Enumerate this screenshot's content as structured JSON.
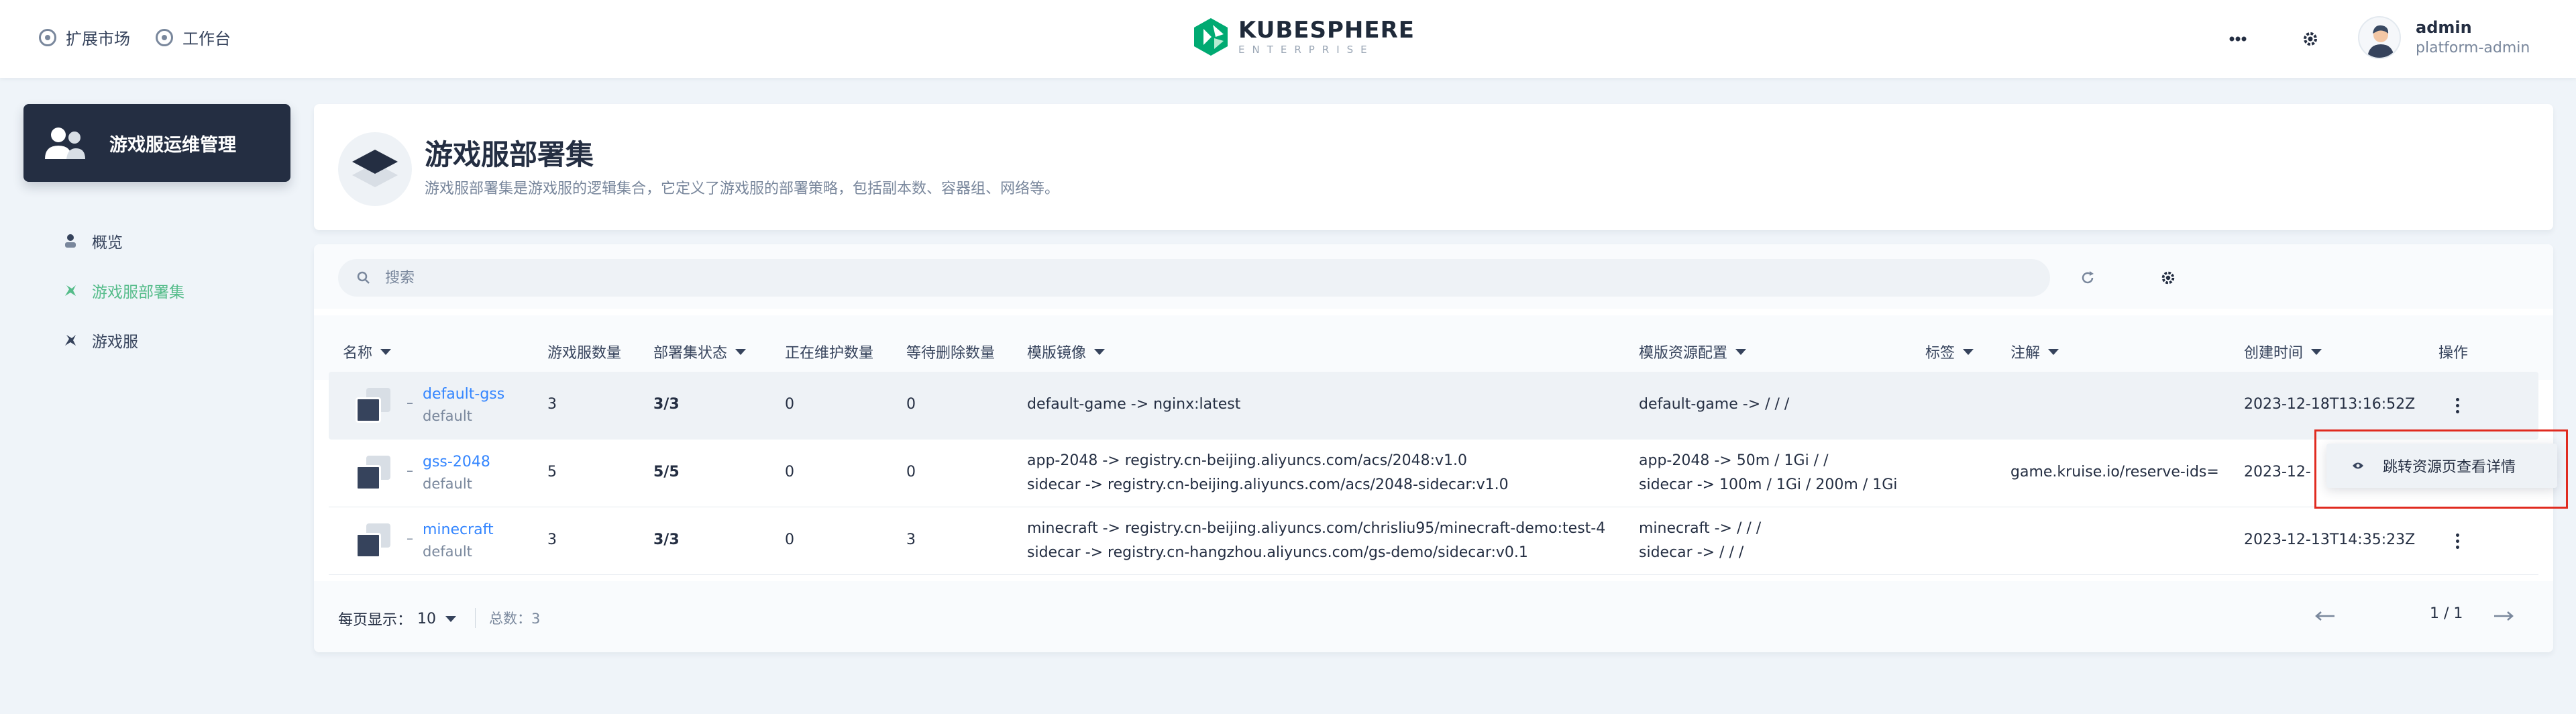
{
  "header": {
    "nav_market": "扩展市场",
    "nav_workbench": "工作台",
    "logo_brand": "KUBESPHERE",
    "logo_sub": "ENTERPRISE",
    "user_name": "admin",
    "user_role": "platform-admin"
  },
  "sidebar": {
    "module_title": "游戏服运维管理",
    "items": [
      {
        "label": "概览",
        "icon": "overview-icon"
      },
      {
        "label": "游戏服部署集",
        "icon": "gameserverset-icon",
        "active": true
      },
      {
        "label": "游戏服",
        "icon": "gameserver-icon"
      }
    ]
  },
  "banner": {
    "title": "游戏服部署集",
    "description": "游戏服部署集是游戏服的逻辑集合，它定义了游戏服的部署策略，包括副本数、容器组、网络等。"
  },
  "search": {
    "placeholder": "搜索"
  },
  "table": {
    "columns": {
      "name": "名称",
      "count": "游戏服数量",
      "status": "部署集状态",
      "maintaining": "正在维护数量",
      "deleting": "等待删除数量",
      "image": "模版镜像",
      "resources": "模版资源配置",
      "labels": "标签",
      "annotations": "注解",
      "created": "创建时间",
      "actions": "操作"
    },
    "rows": [
      {
        "dash": "–",
        "name": "default-gss",
        "namespace": "default",
        "count": "3",
        "status": "3/3",
        "maintaining": "0",
        "deleting": "0",
        "image_1": "default-game -> nginx:latest",
        "image_2": "",
        "resources_1": "default-game -> / / /",
        "resources_2": "",
        "annotation": "",
        "created": "2023-12-18T13:16:52Z"
      },
      {
        "dash": "–",
        "name": "gss-2048",
        "namespace": "default",
        "count": "5",
        "status": "5/5",
        "maintaining": "0",
        "deleting": "0",
        "image_1": "app-2048 -> registry.cn-beijing.aliyuncs.com/acs/2048:v1.0",
        "image_2": "sidecar -> registry.cn-beijing.aliyuncs.com/acs/2048-sidecar:v1.0",
        "resources_1": "app-2048 -> 50m / 1Gi / /",
        "resources_2": "sidecar -> 100m / 1Gi / 200m / 1Gi",
        "annotation": "game.kruise.io/reserve-ids=",
        "created": "2023-12-"
      },
      {
        "dash": "–",
        "name": "minecraft",
        "namespace": "default",
        "count": "3",
        "status": "3/3",
        "maintaining": "0",
        "deleting": "3",
        "image_1": "minecraft -> registry.cn-beijing.aliyuncs.com/chrisliu95/minecraft-demo:test-4",
        "image_2": "sidecar -> registry.cn-hangzhou.aliyuncs.com/gs-demo/sidecar:v0.1",
        "resources_1": "minecraft -> / / /",
        "resources_2": "sidecar -> / / /",
        "annotation": "",
        "created": "2023-12-13T14:35:23Z"
      }
    ]
  },
  "popover": {
    "label": "跳转资源页查看详情"
  },
  "footer": {
    "page_size_label": "每页显示：",
    "page_size": "10",
    "total": "总数：3",
    "page": "1 / 1"
  },
  "colors": {
    "accent_green": "#55bc8a",
    "link_blue": "#3385ff",
    "dark": "#242e42",
    "highlight_red": "#e02b20"
  }
}
